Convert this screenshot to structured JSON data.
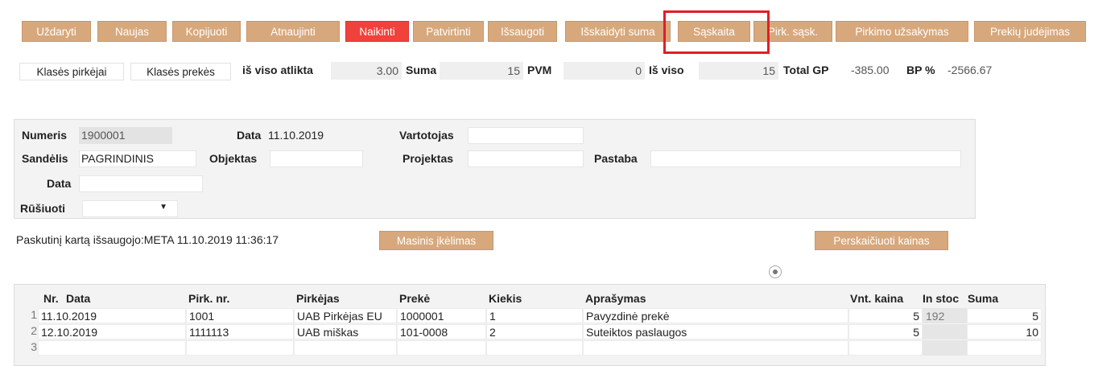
{
  "toolbar": {
    "buttons": [
      "Uždaryti",
      "Naujas",
      "Kopijuoti",
      "Atnaujinti",
      "Naikinti",
      "Patvirtinti",
      "Išsaugoti",
      "Išskaidyti suma",
      "Sąskaita",
      "Pirk. sąsk.",
      "Pirkimo užsakymas",
      "Prekių judėjimas"
    ],
    "danger_color": "#f0413b",
    "accent_color": "#d7a87c",
    "highlight_color": "#e01e26"
  },
  "summary": {
    "tab_buyers": "Klasės pirkėjai",
    "tab_goods": "Klasės prekės",
    "total_done_label": "iš viso atlikta",
    "total_done_value": "3.00",
    "sum_label": "Suma",
    "sum_value": "15",
    "vat_label": "PVM",
    "vat_value": "0",
    "total_label": "Iš viso",
    "total_value": "15",
    "total_gp_label": "Total GP",
    "total_gp_value": "-385.00",
    "bp_label": "BP %",
    "bp_value": "-2566.67"
  },
  "form": {
    "number_label": "Numeris",
    "number_value": "1900001",
    "date_label": "Data",
    "date_value": "11.10.2019",
    "user_label": "Vartotojas",
    "user_value": "",
    "warehouse_label": "Sandėlis",
    "warehouse_value": "PAGRINDINIS",
    "object_label": "Objektas",
    "object_value": "",
    "project_label": "Projektas",
    "project_value": "",
    "note_label": "Pastaba",
    "note_value": "",
    "date2_label": "Data",
    "date2_value": "",
    "sort_label": "Rūšiuoti",
    "sort_value": "",
    "sort_arrow": "▼"
  },
  "status": {
    "last_saved": "Paskutinį kartą išsaugojo:META 11.10.2019 11:36:17",
    "mass_import_label": "Masinis įkėlimas",
    "recalc_label": "Perskaičiuoti kainas"
  },
  "table": {
    "columns": [
      "Nr.",
      "Data",
      "Pirk. nr.",
      "Pirkėjas",
      "Prekė",
      "Kiekis",
      "Aprašymas",
      "Vnt. kaina",
      "In stoc",
      "Suma"
    ],
    "rows": [
      {
        "nr": "1",
        "date": "11.10.2019",
        "purchase_nr": "1001",
        "buyer": "UAB Pirkėjas EU",
        "item": "1000001",
        "qty": "1",
        "description": "Pavyzdinė prekė",
        "unit_price": "5",
        "in_stock": "192",
        "sum": "5"
      },
      {
        "nr": "2",
        "date": "12.10.2019",
        "purchase_nr": "1111113",
        "buyer": "UAB miškas",
        "item": "101-0008",
        "qty": "2",
        "description": "Suteiktos paslaugos",
        "unit_price": "5",
        "in_stock": "",
        "sum": "10"
      },
      {
        "nr": "3",
        "date": "",
        "purchase_nr": "",
        "buyer": "",
        "item": "",
        "qty": "",
        "description": "",
        "unit_price": "",
        "in_stock": "",
        "sum": ""
      }
    ]
  }
}
